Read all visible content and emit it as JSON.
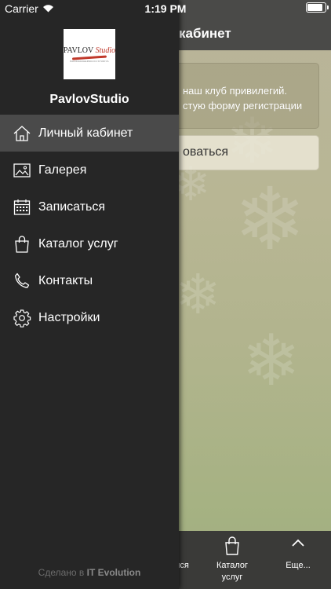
{
  "status_bar": {
    "carrier": "Carrier",
    "time": "1:19 PM",
    "battery_level": 0.95
  },
  "background": {
    "header_title": "кабинет",
    "info_line1": "наш клуб привилегий.",
    "info_line2": "стую форму регистрации",
    "button_label": "оваться",
    "tabs": [
      {
        "label": "ися",
        "icon": ""
      },
      {
        "label": "Каталог\nуслуг",
        "icon": "bag-icon"
      },
      {
        "label": "Еще...",
        "icon": "chevron-up-icon"
      }
    ]
  },
  "drawer": {
    "logo": {
      "name": "PAVLOV",
      "script": "Studio",
      "tagline": "PARIKMAKHERSKAYA STUDIYA"
    },
    "brand": "PavlovStudio",
    "menu": [
      {
        "label": "Личный кабинет",
        "icon": "home-icon",
        "active": true
      },
      {
        "label": "Галерея",
        "icon": "image-icon"
      },
      {
        "label": "Записаться",
        "icon": "calendar-icon"
      },
      {
        "label": "Каталог услуг",
        "icon": "bag-icon"
      },
      {
        "label": "Контакты",
        "icon": "phone-icon"
      },
      {
        "label": "Настройки",
        "icon": "gear-icon"
      }
    ],
    "footer_prefix": "Сделано в",
    "footer_brand": "IT Evolution"
  }
}
